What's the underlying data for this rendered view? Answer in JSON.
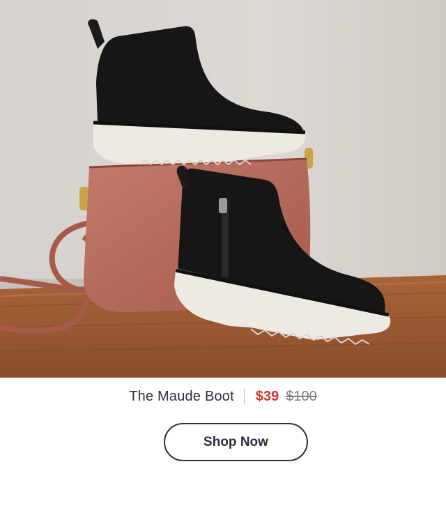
{
  "hero": {
    "image_subject": "black ankle boots with white lug soles on a rose leather crossbody bag"
  },
  "product": {
    "name": "The Maude Boot",
    "sale_price": "$39",
    "original_price": "$100"
  },
  "cta": {
    "label": "Shop Now"
  },
  "colors": {
    "text": "#2b2d42",
    "sale_price": "#d8362f",
    "original_price": "#7a7c88"
  }
}
